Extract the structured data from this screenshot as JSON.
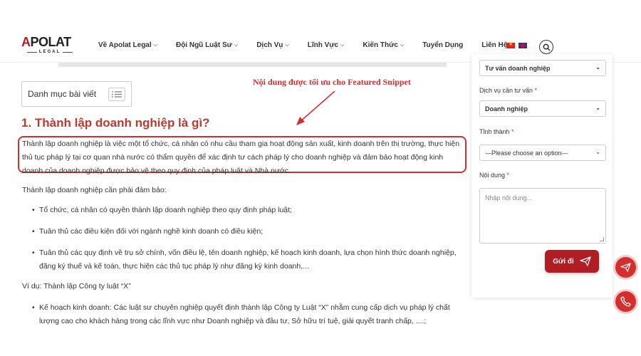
{
  "header": {
    "logo_text_a": "A",
    "logo_text_rest": "POLAT",
    "logo_sub": "LEGAL",
    "nav": [
      {
        "label": "Về Apolat Legal",
        "has_dropdown": true
      },
      {
        "label": "Đội Ngũ Luật Sư",
        "has_dropdown": true
      },
      {
        "label": "Dịch Vụ",
        "has_dropdown": true
      },
      {
        "label": "Lĩnh Vực",
        "has_dropdown": true
      },
      {
        "label": "Kiến Thức",
        "has_dropdown": true
      },
      {
        "label": "Tuyển Dụng",
        "has_dropdown": false
      },
      {
        "label": "Liên Hệ",
        "has_dropdown": false
      }
    ],
    "brand_color": "#b01e23"
  },
  "toc": {
    "label": "Danh mục bài viết"
  },
  "annotation": "Nội dung được tối ưu cho Featured Snippet",
  "article": {
    "heading": "1. Thành lập doanh nghiệp là gì?",
    "definition": "Thành lập doanh nghiệp là việc một tổ chức, cá nhân có nhu cầu tham gia hoạt động sản xuất, kinh doanh trên thị trường, thực hiện thủ tục pháp lý tại cơ quan nhà nước có thẩm quyền để xác định tư cách pháp lý cho doanh nghiệp và đảm bảo hoạt động kinh doanh của doanh nghiệp được bảo vệ theo quy định của pháp luật và Nhà nước.",
    "requirements_intro": "Thành lập doanh nghiệp cần phải đảm bảo:",
    "requirements": [
      "Tổ chức, cá nhân có quyền thành lập doanh nghiệp theo quy định pháp luật;",
      "Tuân thủ các điều kiện đối với ngành nghề kinh doanh có điều kiện;",
      "Tuân thủ các quy định về trụ sở chính, vốn điều lệ, tên doanh nghiệp, kế hoạch kinh doanh, lựa chọn hình thức doanh nghiệp, đăng ký thuế và kế toán, thực hiện các thủ tục pháp lý như đăng ký kinh doanh,..."
    ],
    "example_intro": "Ví dụ: Thành lập Công ty luật “X”",
    "example_items": [
      "Kế hoạch kinh doanh: Các luật sư chuyên nghiệp quyết định thành lập Công ty Luật “X” nhằm cung cấp dịch vụ pháp lý chất lượng cao cho khách hàng trong các lĩnh vực như Doanh nghiệp và đầu tư, Sở hữu trí tuệ, giải quyết tranh chấp, ....;"
    ]
  },
  "form": {
    "field1_value": "Tư vấn doanh nghiệp",
    "service_label": "Dịch vụ cần tư vấn",
    "service_value": "Doanh nghiệp",
    "province_label": "Tỉnh thành",
    "province_value": "—Please choose an option—",
    "content_label": "Nội dung",
    "content_placeholder": "Nhập nội dung...",
    "required_mark": "*",
    "submit_label": "Gửi đi"
  },
  "accent_color": "#d32f2f"
}
